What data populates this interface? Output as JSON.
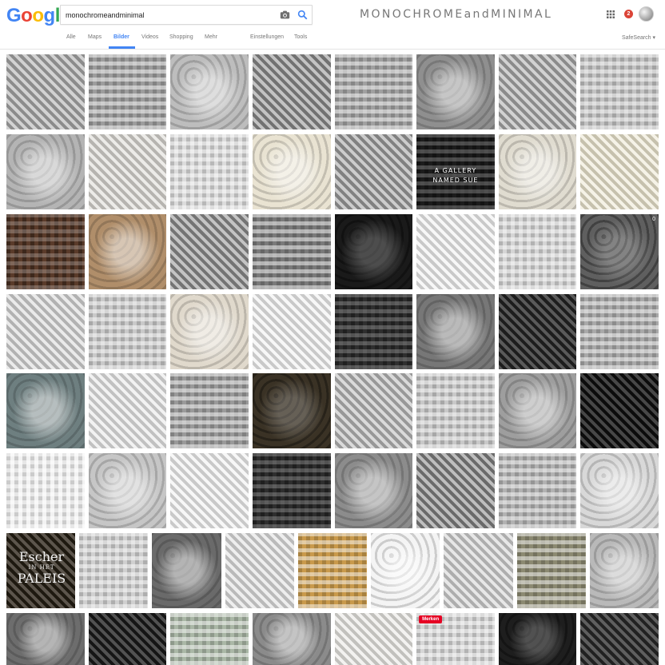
{
  "logo": {
    "text": "Google",
    "letters": [
      "G",
      "o",
      "o",
      "g",
      "l",
      "e"
    ],
    "colors": [
      "#4285f4",
      "#ea4335",
      "#fbbc05",
      "#4285f4",
      "#34a853",
      "#ea4335"
    ]
  },
  "search": {
    "value": "monochromeandminimal"
  },
  "brand_title": "MONOCHROMEandMINIMAL",
  "notifications": {
    "count": "2"
  },
  "tabs": [
    {
      "label": "Alle"
    },
    {
      "label": "Maps"
    },
    {
      "label": "Bilder"
    },
    {
      "label": "Videos"
    },
    {
      "label": "Shopping"
    },
    {
      "label": "Mehr"
    },
    {
      "label": "Einstellungen"
    },
    {
      "label": "Tools"
    }
  ],
  "safesearch": "SafeSearch ▾",
  "overlays": {
    "gallery": "A GALLERY\nNAMED SUE",
    "escher_big": "Escher",
    "escher_small": "IN HET",
    "escher_big2": "PALEIS",
    "merken": "Merken",
    "count": "0"
  },
  "colors": {
    "accent": "#4285f4",
    "badge": "#db4437",
    "merken": "#e60023"
  },
  "image_rows": [
    [
      "#a7a7a7",
      "#9d9d9d",
      "#bdbdbd",
      "#888888",
      "#a1a1a1",
      "#8f8f8f",
      "#a6a6a6",
      "#c3c3c3"
    ],
    [
      "#b4b4b4",
      "#d9d7d2",
      "#dcdcdc",
      "#e9e3d2",
      "#9a9a9a",
      "#1c1c1c",
      "#e0dcd0",
      "#ece6cf"
    ],
    [
      "#5a3b2a",
      "#b08e6a",
      "#8a8a8a",
      "#7a7a7a",
      "#1a1a1a",
      "#f0f0f0",
      "#d5d5d5",
      "#5f5f5f"
    ],
    [
      "#d5d5d5",
      "#c9c9c9",
      "#e0d9cc",
      "#f0f0f0",
      "#2f2f2f",
      "#777777",
      "#2a2a2a",
      "#a9a9a9"
    ],
    [
      "#6e7f80",
      "#e6e6e6",
      "#9a9a9a",
      "#3a3225",
      "#b5b5b5",
      "#c8c8c8",
      "#9e9e9e",
      "#111111"
    ],
    [
      "#f2f2f2",
      "#c6c6c6",
      "#f0f0f0",
      "#2e2e2e",
      "#8c8c8c",
      "#7f7f7f",
      "#b2b2b2",
      "#d8d8d8"
    ],
    [
      "#2c2418",
      "#d0d0d0",
      "#6a6a6a",
      "#dedede",
      "#c99a4c",
      "#f4f4f4",
      "#cfcfcf",
      "#8c8a72",
      "#b9b9b9"
    ],
    [
      "#6d6d6d",
      "#1f1f1f",
      "#aab7a6",
      "#8b8b8b",
      "#e8e6e2",
      "#d6d6d6",
      "#1e1e1e",
      "#303030"
    ]
  ]
}
